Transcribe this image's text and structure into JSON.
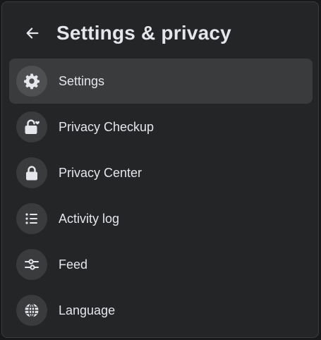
{
  "header": {
    "title": "Settings & privacy"
  },
  "menu": {
    "items": [
      {
        "label": "Settings",
        "icon": "gear-icon",
        "active": true
      },
      {
        "label": "Privacy Checkup",
        "icon": "lock-heart-icon"
      },
      {
        "label": "Privacy Center",
        "icon": "lock-icon"
      },
      {
        "label": "Activity log",
        "icon": "list-icon"
      },
      {
        "label": "Feed",
        "icon": "sliders-icon"
      },
      {
        "label": "Language",
        "icon": "globe-icon"
      }
    ]
  },
  "colors": {
    "background": "#242526",
    "item_active": "#3a3b3c",
    "icon_circle": "#3a3b3c",
    "text": "#e4e6eb"
  }
}
